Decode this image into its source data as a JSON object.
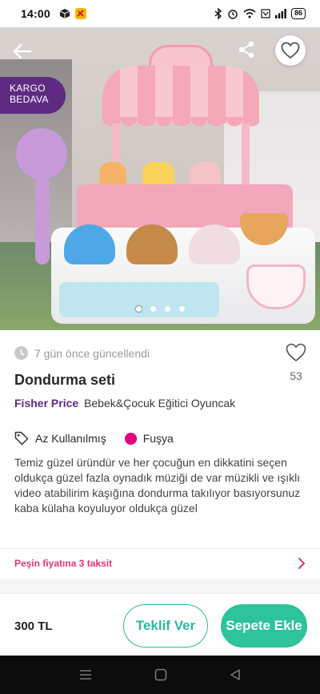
{
  "status_bar": {
    "time": "14:00",
    "battery": "86"
  },
  "hero": {
    "badge_line1": "KARGO",
    "badge_line2": "BEDAVA",
    "image_count": 4,
    "active_image": 1
  },
  "listing": {
    "updated": "7 gün önce güncellendi",
    "like_count": "53",
    "title": "Dondurma seti",
    "brand": "Fisher Price",
    "category": "Bebek&Çocuk Eğitici Oyuncak",
    "condition": "Az Kullanılmış",
    "color": "Fuşya",
    "color_hex": "#e6007a",
    "description": "Temiz güzel üründür ve her çocuğun en dikkatini seçen oldukça güzel fazla oynadık müziği de var müzikli ve ışıklı video atabilirim kaşığına dondurma takılıyor basıyorsunuz kaba külaha koyuluyor oldukça güzel"
  },
  "installment": {
    "label": "Peşin fiyatına 3 taksit"
  },
  "bottom_bar": {
    "price": "300 TL",
    "offer_label": "Teklif Ver",
    "cart_label": "Sepete Ekle"
  },
  "colors": {
    "brand_purple": "#5f2b82",
    "accent_green": "#2ec39b",
    "installment_pink": "#e0386e"
  },
  "icons": [
    "back-arrow-icon",
    "share-icon",
    "heart-icon",
    "clock-icon",
    "tag-icon",
    "chevron-right-icon"
  ]
}
